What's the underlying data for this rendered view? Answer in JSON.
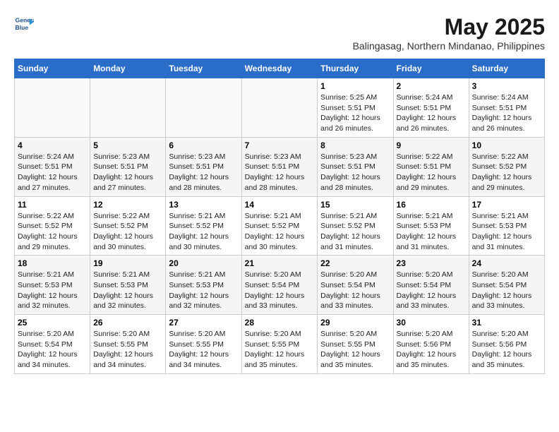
{
  "logo": {
    "line1": "General",
    "line2": "Blue"
  },
  "title": "May 2025",
  "location": "Balingasag, Northern Mindanao, Philippines",
  "weekdays": [
    "Sunday",
    "Monday",
    "Tuesday",
    "Wednesday",
    "Thursday",
    "Friday",
    "Saturday"
  ],
  "weeks": [
    [
      {
        "day": "",
        "info": ""
      },
      {
        "day": "",
        "info": ""
      },
      {
        "day": "",
        "info": ""
      },
      {
        "day": "",
        "info": ""
      },
      {
        "day": "1",
        "info": "Sunrise: 5:25 AM\nSunset: 5:51 PM\nDaylight: 12 hours\nand 26 minutes."
      },
      {
        "day": "2",
        "info": "Sunrise: 5:24 AM\nSunset: 5:51 PM\nDaylight: 12 hours\nand 26 minutes."
      },
      {
        "day": "3",
        "info": "Sunrise: 5:24 AM\nSunset: 5:51 PM\nDaylight: 12 hours\nand 26 minutes."
      }
    ],
    [
      {
        "day": "4",
        "info": "Sunrise: 5:24 AM\nSunset: 5:51 PM\nDaylight: 12 hours\nand 27 minutes."
      },
      {
        "day": "5",
        "info": "Sunrise: 5:23 AM\nSunset: 5:51 PM\nDaylight: 12 hours\nand 27 minutes."
      },
      {
        "day": "6",
        "info": "Sunrise: 5:23 AM\nSunset: 5:51 PM\nDaylight: 12 hours\nand 28 minutes."
      },
      {
        "day": "7",
        "info": "Sunrise: 5:23 AM\nSunset: 5:51 PM\nDaylight: 12 hours\nand 28 minutes."
      },
      {
        "day": "8",
        "info": "Sunrise: 5:23 AM\nSunset: 5:51 PM\nDaylight: 12 hours\nand 28 minutes."
      },
      {
        "day": "9",
        "info": "Sunrise: 5:22 AM\nSunset: 5:51 PM\nDaylight: 12 hours\nand 29 minutes."
      },
      {
        "day": "10",
        "info": "Sunrise: 5:22 AM\nSunset: 5:52 PM\nDaylight: 12 hours\nand 29 minutes."
      }
    ],
    [
      {
        "day": "11",
        "info": "Sunrise: 5:22 AM\nSunset: 5:52 PM\nDaylight: 12 hours\nand 29 minutes."
      },
      {
        "day": "12",
        "info": "Sunrise: 5:22 AM\nSunset: 5:52 PM\nDaylight: 12 hours\nand 30 minutes."
      },
      {
        "day": "13",
        "info": "Sunrise: 5:21 AM\nSunset: 5:52 PM\nDaylight: 12 hours\nand 30 minutes."
      },
      {
        "day": "14",
        "info": "Sunrise: 5:21 AM\nSunset: 5:52 PM\nDaylight: 12 hours\nand 30 minutes."
      },
      {
        "day": "15",
        "info": "Sunrise: 5:21 AM\nSunset: 5:52 PM\nDaylight: 12 hours\nand 31 minutes."
      },
      {
        "day": "16",
        "info": "Sunrise: 5:21 AM\nSunset: 5:53 PM\nDaylight: 12 hours\nand 31 minutes."
      },
      {
        "day": "17",
        "info": "Sunrise: 5:21 AM\nSunset: 5:53 PM\nDaylight: 12 hours\nand 31 minutes."
      }
    ],
    [
      {
        "day": "18",
        "info": "Sunrise: 5:21 AM\nSunset: 5:53 PM\nDaylight: 12 hours\nand 32 minutes."
      },
      {
        "day": "19",
        "info": "Sunrise: 5:21 AM\nSunset: 5:53 PM\nDaylight: 12 hours\nand 32 minutes."
      },
      {
        "day": "20",
        "info": "Sunrise: 5:21 AM\nSunset: 5:53 PM\nDaylight: 12 hours\nand 32 minutes."
      },
      {
        "day": "21",
        "info": "Sunrise: 5:20 AM\nSunset: 5:54 PM\nDaylight: 12 hours\nand 33 minutes."
      },
      {
        "day": "22",
        "info": "Sunrise: 5:20 AM\nSunset: 5:54 PM\nDaylight: 12 hours\nand 33 minutes."
      },
      {
        "day": "23",
        "info": "Sunrise: 5:20 AM\nSunset: 5:54 PM\nDaylight: 12 hours\nand 33 minutes."
      },
      {
        "day": "24",
        "info": "Sunrise: 5:20 AM\nSunset: 5:54 PM\nDaylight: 12 hours\nand 33 minutes."
      }
    ],
    [
      {
        "day": "25",
        "info": "Sunrise: 5:20 AM\nSunset: 5:54 PM\nDaylight: 12 hours\nand 34 minutes."
      },
      {
        "day": "26",
        "info": "Sunrise: 5:20 AM\nSunset: 5:55 PM\nDaylight: 12 hours\nand 34 minutes."
      },
      {
        "day": "27",
        "info": "Sunrise: 5:20 AM\nSunset: 5:55 PM\nDaylight: 12 hours\nand 34 minutes."
      },
      {
        "day": "28",
        "info": "Sunrise: 5:20 AM\nSunset: 5:55 PM\nDaylight: 12 hours\nand 35 minutes."
      },
      {
        "day": "29",
        "info": "Sunrise: 5:20 AM\nSunset: 5:55 PM\nDaylight: 12 hours\nand 35 minutes."
      },
      {
        "day": "30",
        "info": "Sunrise: 5:20 AM\nSunset: 5:56 PM\nDaylight: 12 hours\nand 35 minutes."
      },
      {
        "day": "31",
        "info": "Sunrise: 5:20 AM\nSunset: 5:56 PM\nDaylight: 12 hours\nand 35 minutes."
      }
    ]
  ]
}
